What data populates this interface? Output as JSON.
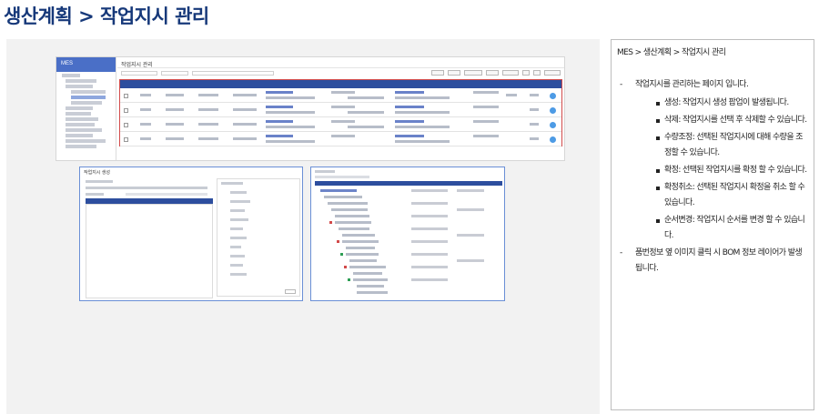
{
  "page_title": "생산계획 > 작업지시 관리",
  "screenshot": {
    "app_name": "MES",
    "screen_title": "작업지시 관리",
    "popup_title": "작업지시 생성",
    "accent_color": "#2d4e9e",
    "highlight_border_color": "#d24a4a"
  },
  "description": {
    "breadcrumb": "MES > 생산계획 > 작업지시 관리",
    "items": [
      {
        "text": "작업지시를 관리하는 페이지 입니다.",
        "sub_items": [
          "생성: 작업지시 생성 팝업이 발생됩니다.",
          "삭제: 작업지시를 선택 후 삭제할 수 있습니다.",
          "수량조정: 선택된 작업지시에 대해 수량을 조정할 수 있습니다.",
          "확정: 선택된 작업지시를 확정 할 수 있습니다.",
          "확정취소: 선택된 작업지시 확정을 취소 할 수 있습니다.",
          "순서변경: 작업지시 순서를 변경 할 수 있습니다."
        ]
      },
      {
        "text": "품번정보 옆 이미지 클릭 시 BOM 정보 레이어가 발생됩니다.",
        "sub_items": []
      }
    ]
  }
}
